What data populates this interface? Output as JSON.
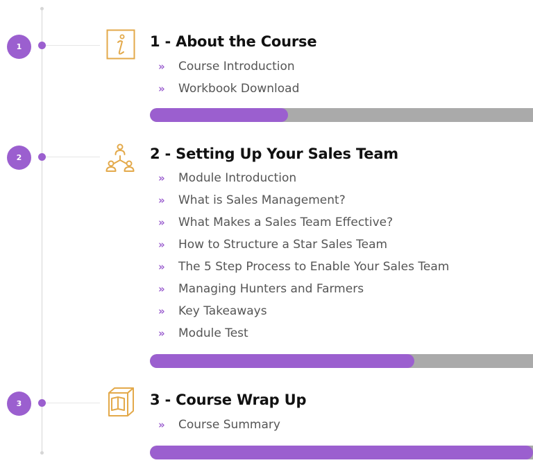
{
  "colors": {
    "accent": "#9b5fcf",
    "track": "#aaaaaa",
    "icon": "#e3a94a",
    "line": "#d6d6d6"
  },
  "modules": [
    {
      "number": "1",
      "icon": "info-icon",
      "title": "1 - About the Course",
      "lessons": [
        "Course Introduction",
        "Workbook Download"
      ],
      "progress": 0.36
    },
    {
      "number": "2",
      "icon": "team-hierarchy-icon",
      "title": "2 - Setting Up Your Sales Team",
      "lessons": [
        "Module Introduction",
        "What is Sales Management?",
        "What Makes a Sales Team Effective?",
        "How to Structure a Star Sales Team",
        "The 5 Step Process to Enable Your Sales Team",
        "Managing Hunters and Farmers",
        "Key Takeaways",
        "Module Test"
      ],
      "progress": 0.69
    },
    {
      "number": "3",
      "icon": "book-box-icon",
      "title": "3 - Course Wrap Up",
      "lessons": [
        "Course Summary"
      ],
      "progress": 1.0
    }
  ]
}
